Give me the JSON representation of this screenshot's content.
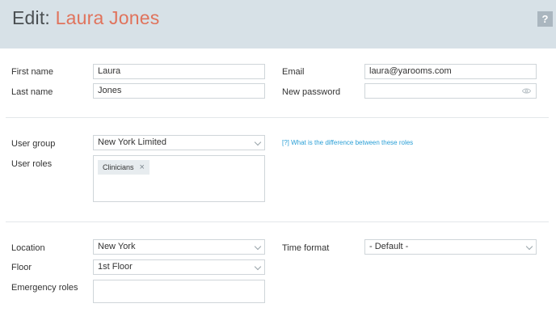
{
  "header": {
    "title_prefix": "Edit:",
    "title_name": "Laura Jones",
    "help_label": "?"
  },
  "account": {
    "first_name_label": "First name",
    "first_name_value": "Laura",
    "last_name_label": "Last name",
    "last_name_value": "Jones",
    "email_label": "Email",
    "email_value": "laura@yarooms.com",
    "password_label": "New password",
    "password_value": ""
  },
  "roles": {
    "user_group_label": "User group",
    "user_group_value": "New York Limited",
    "roles_help_link": "[?] What is the difference between these roles",
    "user_roles_label": "User roles",
    "user_roles_tags": [
      "Clinicians"
    ]
  },
  "location": {
    "location_label": "Location",
    "location_value": "New York",
    "floor_label": "Floor",
    "floor_value": "1st Floor",
    "emergency_label": "Emergency roles",
    "emergency_value": "",
    "time_format_label": "Time format",
    "time_format_value": "- Default -"
  },
  "colors": {
    "header_bg": "#d7e1e7",
    "accent_name": "#e0735c",
    "link": "#2a9fd6"
  }
}
